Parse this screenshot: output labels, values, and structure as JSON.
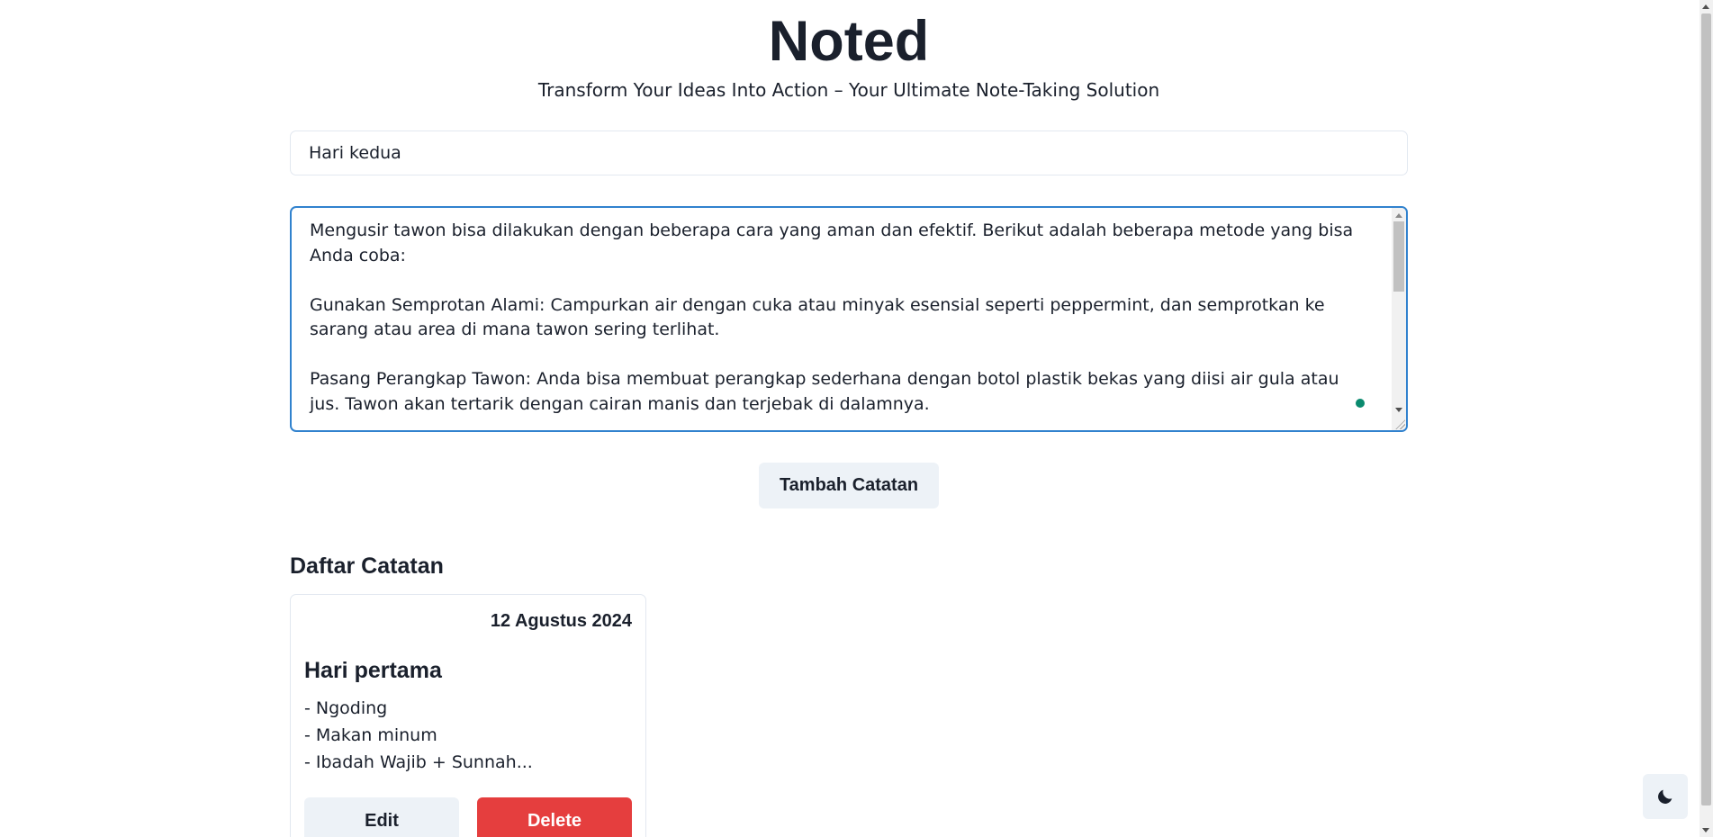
{
  "header": {
    "title": "Noted",
    "tagline": "Transform Your Ideas Into Action – Your Ultimate Note-Taking Solution"
  },
  "form": {
    "title_value": "Hari kedua",
    "body_value": "Mengusir tawon bisa dilakukan dengan beberapa cara yang aman dan efektif. Berikut adalah beberapa metode yang bisa Anda coba:\n\nGunakan Semprotan Alami: Campurkan air dengan cuka atau minyak esensial seperti peppermint, dan semprotkan ke sarang atau area di mana tawon sering terlihat.\n\nPasang Perangkap Tawon: Anda bisa membuat perangkap sederhana dengan botol plastik bekas yang diisi air gula atau jus. Tawon akan tertarik dengan cairan manis dan terjebak di dalamnya.",
    "add_button_label": "Tambah Catatan"
  },
  "notes_section": {
    "heading": "Daftar Catatan",
    "notes": [
      {
        "date": "12 Agustus 2024",
        "title": "Hari pertama",
        "body": "- Ngoding\n- Makan minum\n- Ibadah Wajib + Sunnah...",
        "edit_label": "Edit",
        "delete_label": "Delete"
      }
    ]
  },
  "theme_toggle": {
    "icon": "moon-icon"
  },
  "colors": {
    "focus_border": "#3182ce",
    "delete": "#e53e3e",
    "button_bg": "#edf2f7",
    "text": "#1a202c"
  }
}
